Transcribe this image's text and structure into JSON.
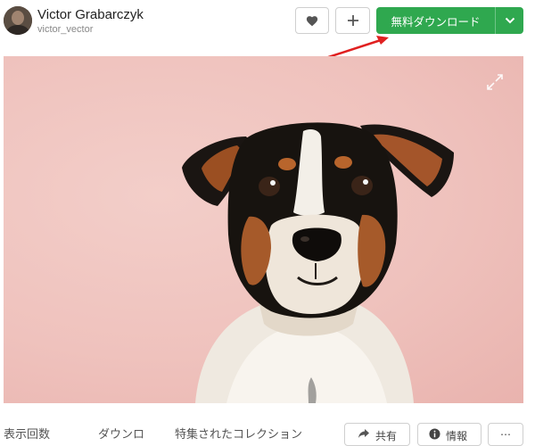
{
  "author": {
    "name": "Victor Grabarczyk",
    "handle": "victor_vector"
  },
  "header": {
    "like_icon": "heart-icon",
    "add_icon": "plus-icon",
    "download_label": "無料ダウンロード",
    "download_menu_icon": "chevron-down-icon",
    "accent_color": "#2fa84f"
  },
  "annotation": {
    "arrow_color": "#e02020"
  },
  "photo": {
    "subject": "dog portrait on pink background",
    "background_color": "#efc2bd",
    "expand_icon": "expand-icon"
  },
  "stats": {
    "views_label": "表示回数",
    "downloads_label": "ダウンロ",
    "collections_label": "特集されたコレクション"
  },
  "actions": {
    "share_label": "共有",
    "info_label": "情報",
    "more_label": "…"
  }
}
